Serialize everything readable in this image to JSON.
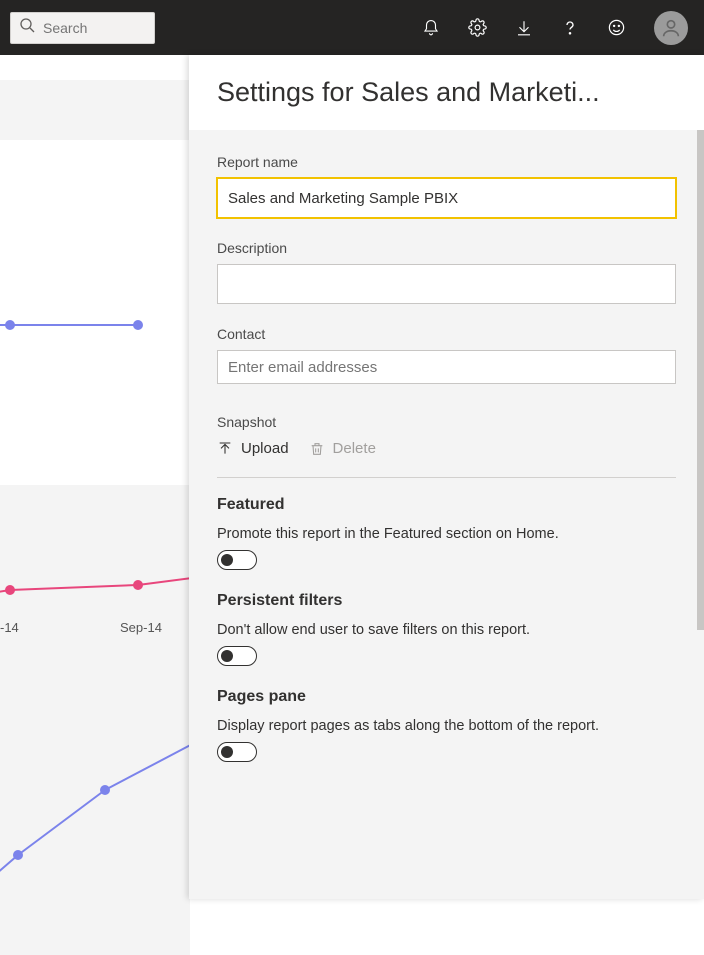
{
  "topbar": {
    "search_placeholder": "Search"
  },
  "background": {
    "axis1": "-14",
    "axis2": "Sep-14"
  },
  "panel": {
    "title": "Settings for Sales and Marketi...",
    "report_name_label": "Report name",
    "report_name_value": "Sales and Marketing Sample PBIX",
    "description_label": "Description",
    "description_value": "",
    "contact_label": "Contact",
    "contact_placeholder": "Enter email addresses",
    "snapshot_label": "Snapshot",
    "upload_label": "Upload",
    "delete_label": "Delete",
    "featured": {
      "title": "Featured",
      "desc": "Promote this report in the Featured section on Home.",
      "state": false
    },
    "persistent": {
      "title": "Persistent filters",
      "desc": "Don't allow end user to save filters on this report.",
      "state": false
    },
    "pages": {
      "title": "Pages pane",
      "desc": "Display report pages as tabs along the bottom of the report.",
      "state": false
    }
  }
}
